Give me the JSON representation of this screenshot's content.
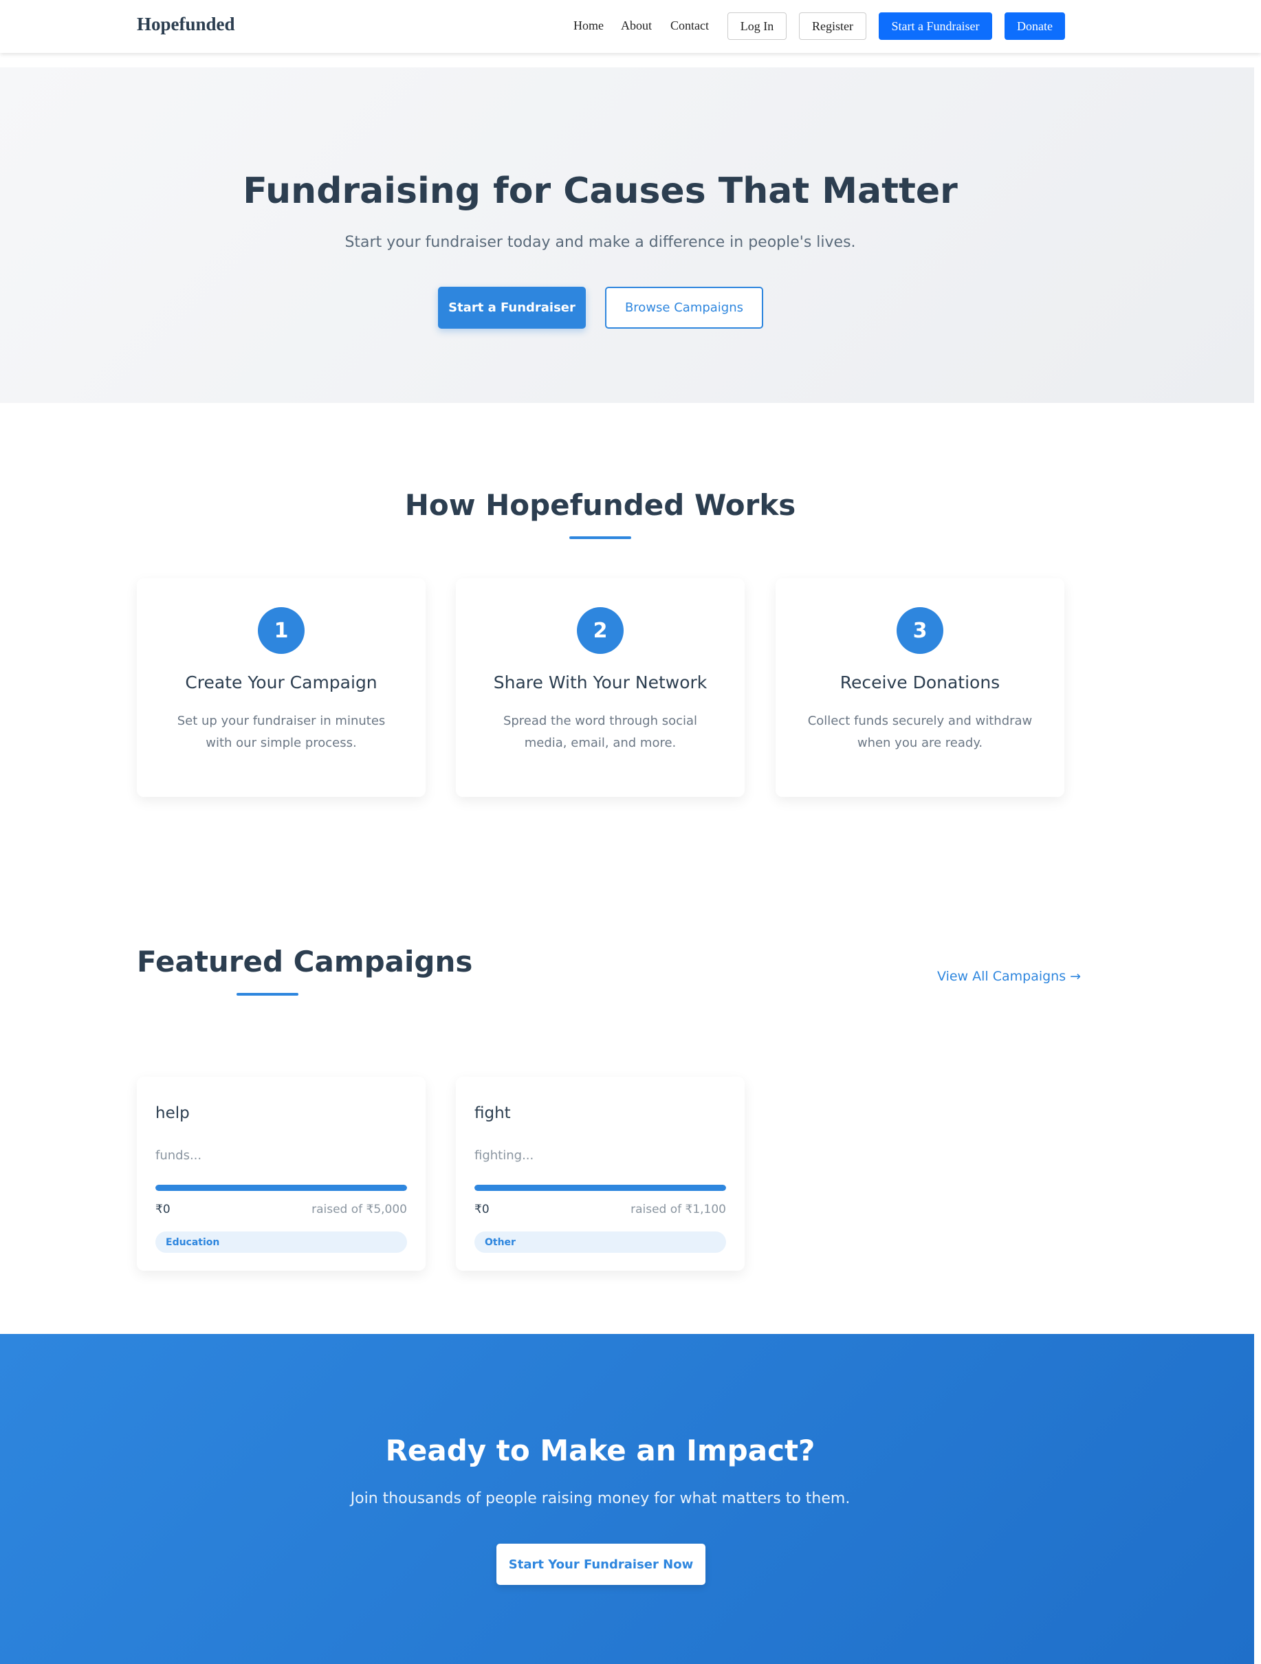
{
  "header": {
    "brand": "Hopefunded",
    "nav": {
      "home": "Home",
      "about": "About",
      "contact": "Contact"
    },
    "login_label": "Log In",
    "register_label": "Register",
    "start_label": "Start a Fundraiser",
    "donate_label": "Donate"
  },
  "hero": {
    "title": "Fundraising for Causes That Matter",
    "subtitle": "Start your fundraiser today and make a difference in people's lives.",
    "primary_cta": "Start a Fundraiser",
    "secondary_cta": "Browse Campaigns"
  },
  "how": {
    "title": "How Hopefunded Works",
    "steps": [
      {
        "number": "1",
        "title": "Create Your Campaign",
        "desc": "Set up your fundraiser in minutes with our simple process."
      },
      {
        "number": "2",
        "title": "Share With Your Network",
        "desc": "Spread the word through social media, email, and more."
      },
      {
        "number": "3",
        "title": "Receive Donations",
        "desc": "Collect funds securely and withdraw when you are ready."
      }
    ]
  },
  "featured": {
    "title": "Featured Campaigns",
    "view_all": "View All Campaigns →",
    "campaigns": [
      {
        "title": "help",
        "desc": "funds...",
        "raised": "₹0",
        "goal_text": "raised of ₹5,000",
        "category": "Education",
        "progress": 1.0
      },
      {
        "title": "fight",
        "desc": "fighting...",
        "raised": "₹0",
        "goal_text": "raised of ₹1,100",
        "category": "Other",
        "progress": 1.0
      }
    ]
  },
  "cta": {
    "title": "Ready to Make an Impact?",
    "subtitle": "Join thousands of people raising money for what matters to them.",
    "button": "Start Your Fundraiser Now"
  },
  "colors": {
    "accent": "#2e86de",
    "nav_button": "#0d6efd",
    "heading": "#2c3e50"
  }
}
